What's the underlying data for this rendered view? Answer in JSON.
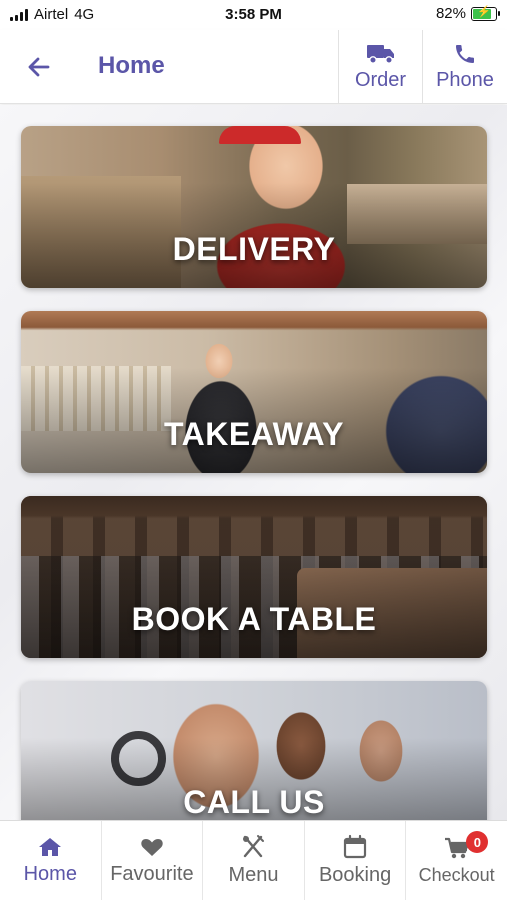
{
  "status_bar": {
    "carrier": "Airtel",
    "network": "4G",
    "time": "3:58 PM",
    "battery": "82%",
    "battery_level": 0.82
  },
  "header": {
    "back_icon": "arrow-left-icon",
    "title": "Home",
    "actions": [
      {
        "label": "Order",
        "icon": "truck-icon"
      },
      {
        "label": "Phone",
        "icon": "phone-icon"
      }
    ]
  },
  "cards": [
    {
      "label": "DELIVERY"
    },
    {
      "label": "TAKEAWAY"
    },
    {
      "label": "BOOK A TABLE"
    },
    {
      "label": "CALL US"
    }
  ],
  "bottom_nav": {
    "items": [
      {
        "label": "Home",
        "icon": "home-icon",
        "active": true
      },
      {
        "label": "Favourite",
        "icon": "heart-icon",
        "active": false
      },
      {
        "label": "Menu",
        "icon": "cutlery-icon",
        "active": false
      },
      {
        "label": "Booking",
        "icon": "calendar-icon",
        "active": false
      },
      {
        "label": "Checkout",
        "icon": "cart-icon",
        "active": false,
        "badge": "0"
      }
    ]
  },
  "colors": {
    "primary": "#5b56a8",
    "inactive": "#666666",
    "badge": "#e03030",
    "battery": "#3cc24a"
  }
}
